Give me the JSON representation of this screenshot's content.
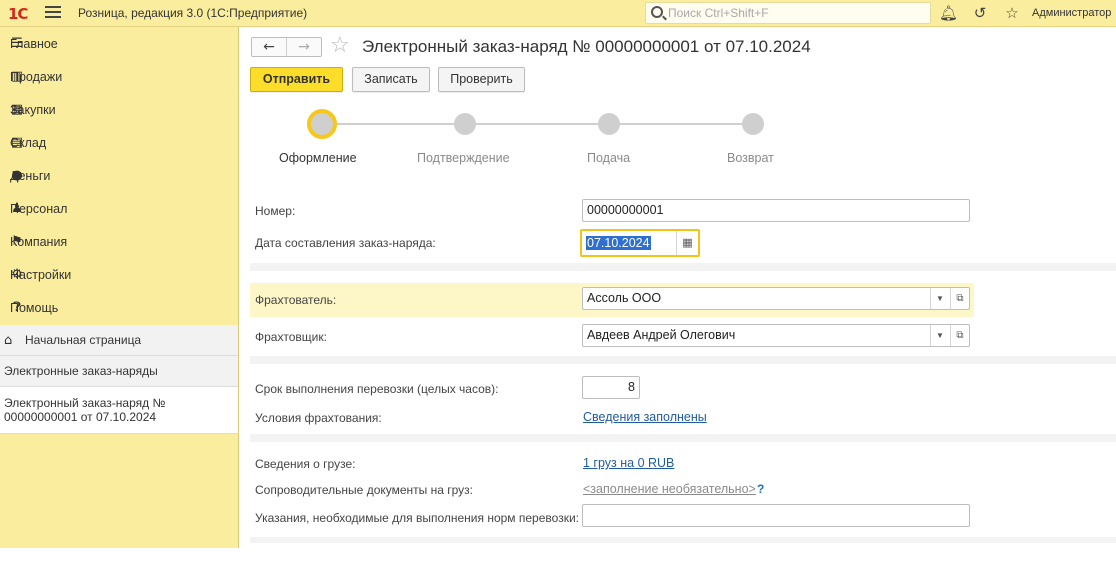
{
  "app": {
    "logo": "1С",
    "title": "Розница, редакция 3.0  (1С:Предприятие)",
    "search_placeholder": "Поиск Ctrl+Shift+F",
    "user": "Администратор"
  },
  "sidebar": {
    "sections": [
      {
        "label": "Главное",
        "icon": "menu-lines-icon"
      },
      {
        "label": "Продажи",
        "icon": "cart-icon"
      },
      {
        "label": "Закупки",
        "icon": "purchase-icon"
      },
      {
        "label": "Склад",
        "icon": "warehouse-icon"
      },
      {
        "label": "Деньги",
        "icon": "coin-icon"
      },
      {
        "label": "Персонал",
        "icon": "people-icon"
      },
      {
        "label": "Компания",
        "icon": "flag-icon"
      },
      {
        "label": "Настройки",
        "icon": "gear-icon"
      },
      {
        "label": "Помощь",
        "icon": "help-icon"
      }
    ],
    "open_windows": {
      "home": "Начальная страница",
      "list": "Электронные заказ-наряды",
      "current_line1": "Электронный заказ-наряд №",
      "current_line2": "00000000001 от 07.10.2024"
    }
  },
  "document": {
    "title": "Электронный заказ-наряд № 00000000001 от 07.10.2024",
    "buttons": {
      "send": "Отправить",
      "save": "Записать",
      "check": "Проверить"
    },
    "steps": [
      "Оформление",
      "Подтверждение",
      "Подача",
      "Возврат"
    ],
    "active_step": "Оформление",
    "form": {
      "number_label": "Номер:",
      "number_value": "00000000001",
      "date_label": "Дата составления заказ-наряда:",
      "date_value": "07.10.2024",
      "charterer_label": "Фрахтователь:",
      "charterer_value": "Ассоль ООО",
      "carrier_label": "Фрахтовщик:",
      "carrier_value": "Авдеев Андрей Олегович",
      "term_label": "Срок выполнения перевозки (целых часов):",
      "term_value": "8",
      "conditions_label": "Условия фрахтования:",
      "conditions_link": "Сведения заполнены",
      "cargo_label": "Сведения о грузе:",
      "cargo_link": "1 груз на 0 RUB",
      "docs_label": "Сопроводительные документы на груз:",
      "docs_link": "<заполнение необязательно>",
      "docs_help": "?",
      "instructions_label": "Указания, необходимые для выполнения норм перевозки:",
      "instructions_value": ""
    }
  },
  "colors": {
    "topbar": "#fbed9e",
    "primary_button": "#fcde2a",
    "active_step_ring": "#f7c71a",
    "link": "#1f5c9e"
  }
}
